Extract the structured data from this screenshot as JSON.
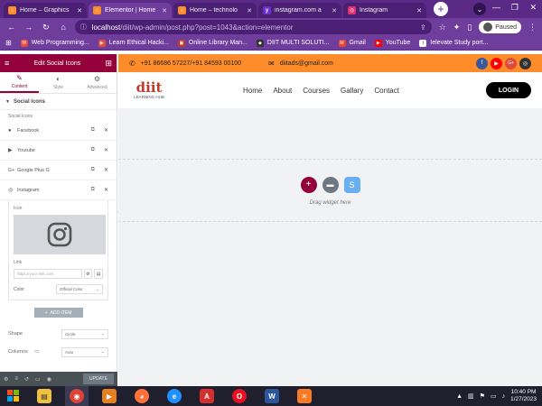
{
  "browser": {
    "tabs": [
      {
        "label": "Home – Graphics",
        "color": "#ff8c2a",
        "active": false
      },
      {
        "label": "Elementor | Home",
        "color": "#ff8c2a",
        "active": true
      },
      {
        "label": "Home – technolo",
        "color": "#ff8c2a",
        "active": false
      },
      {
        "label": "instagram.com a",
        "color": "#6a2fd1",
        "active": false
      },
      {
        "label": "Instagram",
        "color": "#e1306c",
        "active": false
      }
    ],
    "url_host": "localhost",
    "url_path": "/diit/wp-admin/post.php?post=1043&action=elementor",
    "profile_label": "Paused",
    "bookmarks": [
      {
        "label": "Web Programming...",
        "color": "#e74c3c",
        "icon": "W"
      },
      {
        "label": "Learn Ethical Hacki...",
        "color": "#e74c3c",
        "icon": "▶"
      },
      {
        "label": "Online Library Man...",
        "color": "#c0392b",
        "icon": "▣"
      },
      {
        "label": "DIIT MULTI SOLUTI...",
        "color": "#333333",
        "icon": "◆"
      },
      {
        "label": "Gmail",
        "color": "#ea4335",
        "icon": "M"
      },
      {
        "label": "YouTube",
        "color": "#ff0000",
        "icon": "▶"
      },
      {
        "label": "Ielevate Study port...",
        "color": "#ffffff",
        "icon": "I"
      }
    ]
  },
  "sidebar": {
    "title": "Edit Social Icons",
    "tabs": [
      {
        "label": "Content",
        "icon": "pencil-icon",
        "active": true
      },
      {
        "label": "Style",
        "icon": "half-circle-icon",
        "active": false
      },
      {
        "label": "Advanced",
        "icon": "gear-icon",
        "active": false
      }
    ],
    "section_title": "Social Icons",
    "repeater_label": "Social Icons",
    "items": [
      {
        "label": "Facebook",
        "icon": "f"
      },
      {
        "label": "Youtube",
        "icon": "▶"
      },
      {
        "label": "Google Plus G",
        "icon": "G+"
      },
      {
        "label": "Instagram",
        "icon": "◎"
      }
    ],
    "icon_field_label": "Icon",
    "link_field_label": "Link",
    "link_placeholder": "https://your-link.com",
    "color_label": "Color",
    "color_value": "Official Color",
    "add_item_label": "ADD ITEM",
    "shape_label": "Shape",
    "shape_value": "Circle",
    "columns_label": "Columns",
    "columns_value": "Auto",
    "update_label": "UPDATE"
  },
  "preview": {
    "phone": "+91 86686 57227/+91 84593 00100",
    "email": "diitads@gmail.com",
    "logo_text": "diit",
    "logo_sub": "LEARNING HUB",
    "nav": [
      "Home",
      "About",
      "Courses",
      "Gallary",
      "Contact"
    ],
    "login_label": "LOGIN",
    "drop_text": "Drag widget here",
    "social_colors": [
      "#3b5998",
      "#ff0000",
      "#dd4b39",
      "#333333"
    ]
  },
  "taskbar": {
    "time": "10:40 PM",
    "date": "1/27/2023"
  }
}
